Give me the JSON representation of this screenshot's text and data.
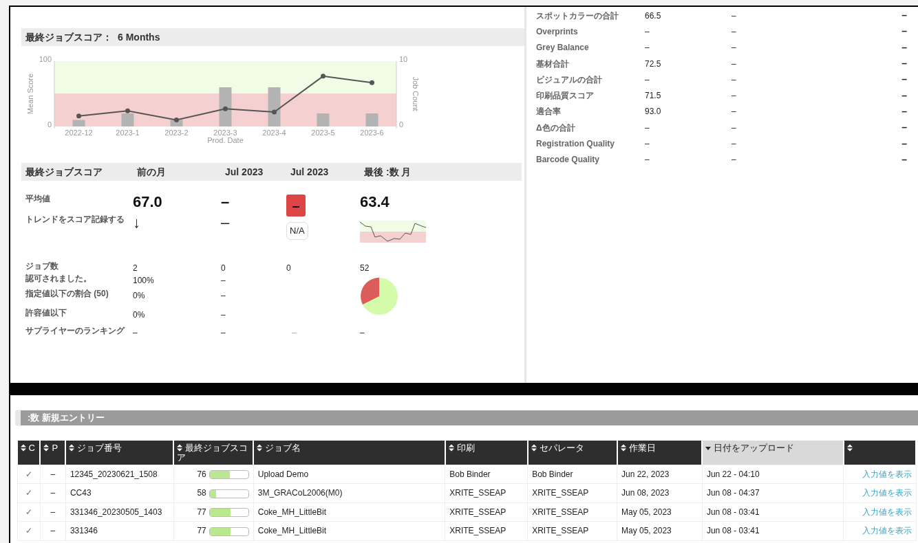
{
  "score_panel": {
    "title": "最終ジョブスコア：",
    "title_period": "6 Months",
    "chart_data": {
      "type": "bar",
      "xlabel": "Prod. Date",
      "ylabel": "Mean Score",
      "y2label": "Job Count",
      "categories": [
        "2022-12",
        "2023-1",
        "2023-2",
        "2023-3",
        "2023-4",
        "2023-5",
        "2023-6"
      ],
      "ylim": [
        0,
        100
      ],
      "yticks": [
        0,
        100
      ],
      "y2lim": [
        0,
        10
      ],
      "y2ticks": [
        0,
        10
      ],
      "series": [
        {
          "axis": "y2",
          "color": "#b3b3b3",
          "values": [
            1,
            2,
            1,
            6,
            6,
            2,
            2
          ]
        },
        {
          "type": "line",
          "axis": "y",
          "marker": "o",
          "color": "#555555",
          "values": [
            16,
            24,
            10,
            27,
            22,
            77,
            67
          ]
        }
      ]
    },
    "table": {
      "columns": [
        "最終ジョブスコア",
        "前の月",
        "Jul 2023",
        "Jul 2023",
        "最後 :数 月"
      ],
      "rows": [
        {
          "kind": "big",
          "cells": [
            {
              "text": "平均値",
              "kind": "label"
            },
            {
              "text": "67.0"
            },
            {
              "text": "–"
            },
            {
              "text": "–",
              "kind": "alert"
            },
            {
              "text": "63.4"
            }
          ]
        },
        {
          "kind": "trend",
          "cells": [
            {
              "text": "トレンドをスコア記録する",
              "kind": "label"
            },
            {
              "text": "↓"
            },
            {
              "text": "–"
            },
            {
              "text": "N/A",
              "kind": "tag"
            },
            {
              "kind": "sparkline"
            }
          ]
        },
        {
          "kind": "plain",
          "cells": [
            {
              "text": "ジョブ数",
              "kind": "label"
            },
            {
              "text": "2"
            },
            {
              "text": "0"
            },
            {
              "text": "0"
            },
            {
              "text": "52"
            }
          ]
        },
        {
          "kind": "plain",
          "cells": [
            {
              "text": "認可されました。",
              "kind": "label"
            },
            {
              "text": "100%"
            },
            {
              "text": "–"
            },
            {
              "kind": "empty"
            },
            {
              "kind": "pie"
            }
          ]
        },
        {
          "kind": "plain",
          "cells": [
            {
              "text": "指定値以下の割合 (50)",
              "kind": "label"
            },
            {
              "text": "0%"
            },
            {
              "text": "–"
            }
          ]
        },
        {
          "kind": "plain",
          "cells": [
            {
              "text": "許容値以下",
              "kind": "label"
            },
            {
              "text": "0%"
            },
            {
              "text": "–"
            }
          ]
        },
        {
          "kind": "plain",
          "cells": [
            {
              "text": "サプライヤーのランキング",
              "kind": "label"
            },
            {
              "text": "–"
            },
            {
              "text": "–"
            },
            {
              "text": "–",
              "kind": "faint"
            },
            {
              "text": "–"
            }
          ]
        }
      ]
    }
  },
  "metrics": [
    {
      "label": "スポットカラーの合計",
      "value": "66.5",
      "column_3": "–",
      "column_4": "–"
    },
    {
      "label": "Overprints",
      "value": "–",
      "column_3": "–",
      "column_4": "–"
    },
    {
      "label": "Grey Balance",
      "value": "–",
      "column_3": "–",
      "column_4": "–"
    },
    {
      "label": "基材合計",
      "value": "72.5",
      "column_3": "–",
      "column_4": "–"
    },
    {
      "label": "ビジュアルの合計",
      "value": "–",
      "column_3": "–",
      "column_4": "–"
    },
    {
      "label": "印刷品質スコア",
      "value": "71.5",
      "column_3": "–",
      "column_4": "–"
    },
    {
      "label": "適合率",
      "value": "93.0",
      "column_3": "–",
      "column_4": "–"
    },
    {
      "label": "Δ色の合計",
      "value": "–",
      "column_3": "–",
      "column_4": "–"
    },
    {
      "label": "Registration Quality",
      "value": "–",
      "column_3": "–",
      "column_4": "–"
    },
    {
      "label": "Barcode Quality",
      "value": "–",
      "column_3": "–",
      "column_4": "–"
    }
  ],
  "entries": {
    "title": ":数 新規エントリー",
    "columns": [
      {
        "label": "C",
        "sorted": false
      },
      {
        "label": "P",
        "sorted": false
      },
      {
        "label": "ジョブ番号",
        "sorted": false
      },
      {
        "label": "最終ジョブスコア",
        "sorted": false
      },
      {
        "label": "ジョブ名",
        "sorted": false
      },
      {
        "label": "印刷",
        "sorted": false
      },
      {
        "label": "セパレータ",
        "sorted": false
      },
      {
        "label": "作業日",
        "sorted": false
      },
      {
        "label": "日付をアップロード",
        "sorted": true
      },
      {
        "sorted": false
      }
    ],
    "rows": [
      {
        "c": "✓",
        "p": "–",
        "job_number": "12345_20230621_1508",
        "score": "76",
        "level": 0.52,
        "job_name": "Upload Demo",
        "printer": "Bob Binder",
        "separator": "Bob Binder",
        "job_date": "Jun 22, 2023",
        "upload_date": "Jun 22 - 04:10",
        "link": "入力値を表示"
      },
      {
        "c": "✓",
        "p": "–",
        "job_number": "CC43",
        "score": "58",
        "level": 0.16,
        "job_name": "3M_GRACoL2006(M0)",
        "printer": "XRITE_SSEAP",
        "separator": "XRITE_SSEAP",
        "job_date": "Jun 08, 2023",
        "upload_date": "Jun 08 - 04:37",
        "link": "入力値を表示"
      },
      {
        "c": "✓",
        "p": "–",
        "job_number": "331346_20230505_1403",
        "score": "77",
        "level": 0.54,
        "job_name": "Coke_MH_LittleBit",
        "printer": "XRITE_SSEAP",
        "separator": "XRITE_SSEAP",
        "job_date": "May 05, 2023",
        "upload_date": "Jun 08 - 03:41",
        "link": "入力値を表示"
      },
      {
        "c": "✓",
        "p": "–",
        "job_number": "331346",
        "score": "77",
        "level": 0.54,
        "job_name": "Coke_MH_LittleBit",
        "printer": "XRITE_SSEAP",
        "separator": "XRITE_SSEAP",
        "job_date": "May 05, 2023",
        "upload_date": "Jun 08 - 03:41",
        "link": "入力値を表示"
      }
    ]
  }
}
